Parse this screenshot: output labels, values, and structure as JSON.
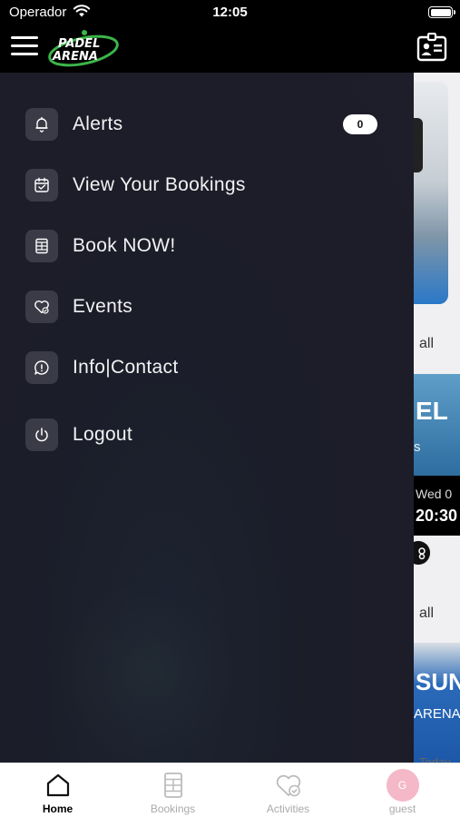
{
  "status_bar": {
    "carrier": "Operador",
    "time": "12:05"
  },
  "app_bar": {
    "logo_line1": "PADEL",
    "logo_line2": "ARENA"
  },
  "menu": {
    "items": [
      {
        "label": "Alerts",
        "icon": "bell-icon",
        "badge": "0"
      },
      {
        "label": "View Your Bookings",
        "icon": "calendar-check-icon"
      },
      {
        "label": "Book NOW!",
        "icon": "court-icon"
      },
      {
        "label": "Events",
        "icon": "heart-check-icon"
      },
      {
        "label": "Info|Contact",
        "icon": "info-chat-icon"
      },
      {
        "label": "Logout",
        "icon": "power-icon"
      }
    ]
  },
  "background_page": {
    "see_all_1": "all",
    "event1": {
      "title": "EL",
      "subtitle": "s",
      "date": "Wed 0",
      "time": "20:30"
    },
    "see_all_2": "all",
    "event2": {
      "title": "SUN",
      "subtitle": "ARENA",
      "date": "Today"
    }
  },
  "tabs": [
    {
      "label": "Home",
      "icon": "home-icon",
      "active": true
    },
    {
      "label": "Bookings",
      "icon": "court-icon",
      "active": false
    },
    {
      "label": "Activities",
      "icon": "heart-check-icon",
      "active": false
    },
    {
      "label": "guest",
      "icon": "avatar",
      "avatar_initial": "G",
      "active": false
    }
  ],
  "colors": {
    "drawer_bg": "#1e1d2a",
    "icon_tile": "#3a3b47",
    "logo_green": "#3cb54a",
    "avatar_bg": "#f4b8c8"
  }
}
